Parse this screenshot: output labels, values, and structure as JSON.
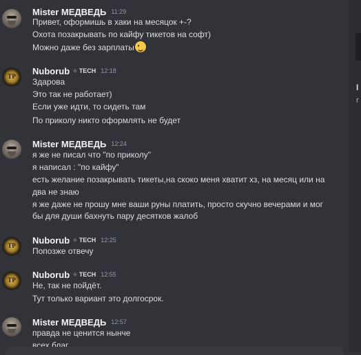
{
  "messages": [
    {
      "author": "Mister МЕДВЕДЬ",
      "time": "11:29",
      "lines": [
        "Привет, оформишь в хаки на месяцок +-?",
        "Охота позакрывать по кайфу тикетов на софт)",
        "Можно даже без зарплаты"
      ]
    },
    {
      "author": "Nuborub",
      "tag": "TECH",
      "time": "12:18",
      "lines": [
        "Здарова",
        "Это так не работает)",
        "Если уже идти, то сидеть там",
        "По приколу никто оформлять не будет"
      ]
    },
    {
      "author": "Mister МЕДВЕДЬ",
      "time": "12:24",
      "lines": [
        "я же не писал что \"по приколу\"",
        "я написал : \"по кайфу\"",
        "есть желание позакрывать тикеты,на скоко меня хватит хз, на месяц или на",
        "два не знаю",
        "я же даже не прошу мне ваши руны платить, просто скучно вечерами и мог",
        "бы для души бахнуть пару десятков жалоб"
      ]
    },
    {
      "author": "Nuborub",
      "tag": "TECH",
      "time": "12:25",
      "lines": [
        "Попозже отвечу"
      ]
    },
    {
      "author": "Nuborub",
      "tag": "TECH",
      "time": "12:55",
      "lines": [
        "Не, так не пойдёт.",
        "Тут только вариант это долгосрок."
      ]
    },
    {
      "author": "Mister МЕДВЕДЬ",
      "time": "12:57",
      "lines": [
        "правда не ценится нынче",
        "всех благ"
      ]
    }
  ],
  "right_panel": {
    "glyph1": "I",
    "glyph2": "r"
  },
  "icons": {
    "emoji": "wink-emoji",
    "tag_icon": "sparkle-icon"
  }
}
